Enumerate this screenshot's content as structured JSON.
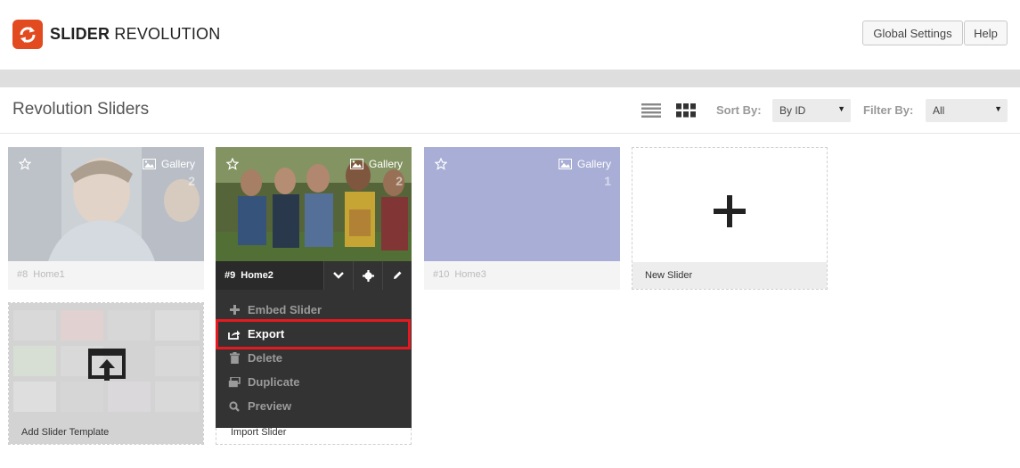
{
  "header": {
    "brand_bold": "SLIDER",
    "brand_rest": " REVOLUTION",
    "global_settings_label": "Global Settings",
    "help_label": "Help"
  },
  "toolbar": {
    "page_title": "Revolution Sliders",
    "sort_label": "Sort By:",
    "sort_value": "By ID",
    "filter_label": "Filter By:",
    "filter_value": "All"
  },
  "sliders": [
    {
      "id": "#8",
      "name": "Home1",
      "type": "Gallery",
      "count": "2"
    },
    {
      "id": "#9",
      "name": "Home2",
      "type": "Gallery",
      "count": "2"
    },
    {
      "id": "#10",
      "name": "Home3",
      "type": "Gallery",
      "count": "1"
    }
  ],
  "new_slider_label": "New Slider",
  "add_template_label": "Add Slider Template",
  "import_label": "Import Slider",
  "menu": [
    {
      "label": "Embed Slider",
      "icon": "plus-icon"
    },
    {
      "label": "Export",
      "icon": "export-icon"
    },
    {
      "label": "Delete",
      "icon": "trash-icon"
    },
    {
      "label": "Duplicate",
      "icon": "duplicate-icon"
    },
    {
      "label": "Preview",
      "icon": "search-icon"
    }
  ],
  "colors": {
    "brand": "#e24a1f",
    "highlight": "#e5191f",
    "menu_bg": "#333333"
  }
}
